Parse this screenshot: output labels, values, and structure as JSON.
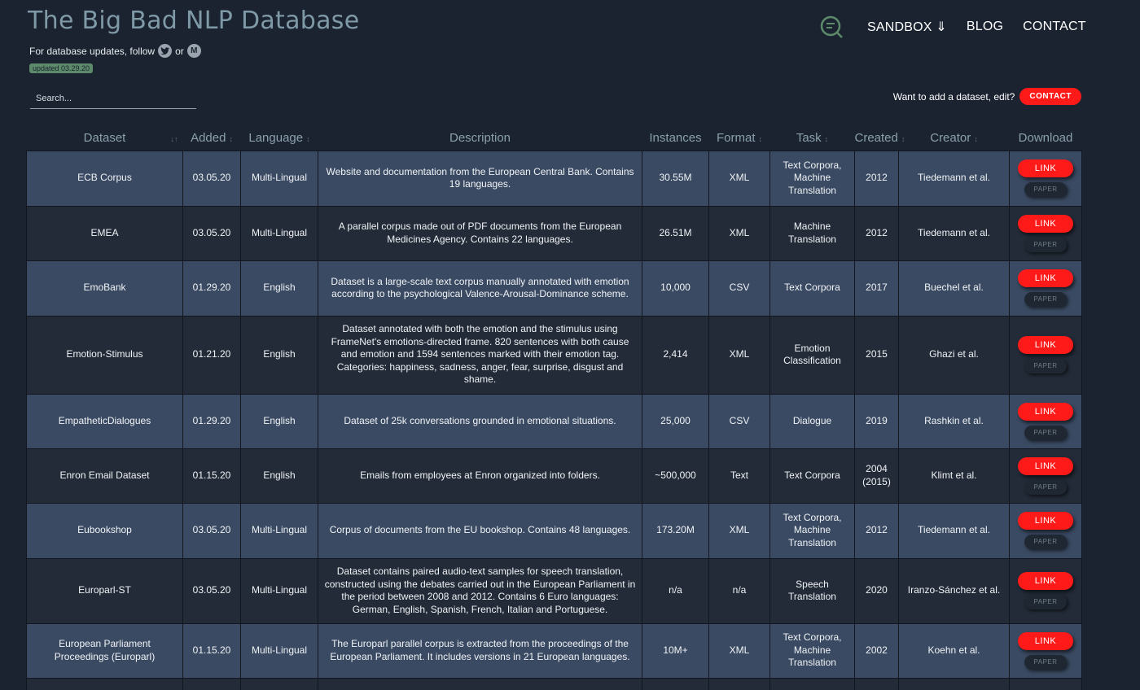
{
  "site": {
    "title": "The Big Bad NLP Database",
    "follow_text": "For database updates, follow",
    "or_text": "or",
    "twitter_icon": "twitter-icon",
    "medium_icon": "medium-icon",
    "updated": "updated 03.29.20"
  },
  "nav": {
    "logo_icon": "q-logo-icon",
    "items": [
      "SANDBOX ⇓",
      "BLOG",
      "CONTACT"
    ]
  },
  "search": {
    "placeholder": "Search..."
  },
  "add_dataset": {
    "text": "Want to add a dataset, edit?",
    "button": "CONTACT"
  },
  "colors": {
    "accent": "#ff1a1a",
    "title": "#7f9aa6",
    "row_odd": "#3a4a62",
    "row_even": "#232b38",
    "background": "#1b2331"
  },
  "table": {
    "headers": [
      "Dataset",
      "Added",
      "Language",
      "Description",
      "Instances",
      "Format",
      "Task",
      "Created",
      "Creator",
      "Download"
    ],
    "link_label": "LINK",
    "paper_label": "PAPER",
    "rows": [
      {
        "dataset": "ECB Corpus",
        "added": "03.05.20",
        "language": "Multi-Lingual",
        "description": "Website and documentation from the European Central Bank. Contains 19 languages.",
        "instances": "30.55M",
        "format": "XML",
        "task": "Text Corpora, Machine Translation",
        "created": "2012",
        "creator": "Tiedemann et al."
      },
      {
        "dataset": "EMEA",
        "added": "03.05.20",
        "language": "Multi-Lingual",
        "description": "A parallel corpus made out of PDF documents from the European Medicines Agency. Contains 22 languages.",
        "instances": "26.51M",
        "format": "XML",
        "task": "Machine Translation",
        "created": "2012",
        "creator": "Tiedemann et al."
      },
      {
        "dataset": "EmoBank",
        "added": "01.29.20",
        "language": "English",
        "description": "Dataset is a large-scale text corpus manually annotated with emotion according to the psychological Valence-Arousal-Dominance scheme.",
        "instances": "10,000",
        "format": "CSV",
        "task": "Text Corpora",
        "created": "2017",
        "creator": "Buechel et al."
      },
      {
        "dataset": "Emotion-Stimulus",
        "added": "01.21.20",
        "language": "English",
        "description": "Dataset annotated with both the emotion and the stimulus using FrameNet's emotions-directed frame. 820 sentences with both cause and emotion and 1594 sentences marked with their emotion tag. Categories: happiness, sadness, anger, fear, surprise, disgust and shame.",
        "instances": "2,414",
        "format": "XML",
        "task": "Emotion Classification",
        "created": "2015",
        "creator": "Ghazi et al."
      },
      {
        "dataset": "EmpatheticDialogues",
        "added": "01.29.20",
        "language": "English",
        "description": "Dataset of 25k conversations grounded in emotional situations.",
        "instances": "25,000",
        "format": "CSV",
        "task": "Dialogue",
        "created": "2019",
        "creator": "Rashkin et al."
      },
      {
        "dataset": "Enron Email Dataset",
        "added": "01.15.20",
        "language": "English",
        "description": "Emails from employees at Enron organized into folders.",
        "instances": "~500,000",
        "format": "Text",
        "task": "Text Corpora",
        "created": "2004 (2015)",
        "creator": "Klimt et al."
      },
      {
        "dataset": "Eubookshop",
        "added": "03.05.20",
        "language": "Multi-Lingual",
        "description": "Corpus of documents from the EU bookshop. Contains 48 languages.",
        "instances": "173.20M",
        "format": "XML",
        "task": "Text Corpora, Machine Translation",
        "created": "2012",
        "creator": "Tiedemann et al."
      },
      {
        "dataset": "Europarl-ST",
        "added": "03.05.20",
        "language": "Multi-Lingual",
        "description": "Dataset contains paired audio-text samples for speech translation, constructed using the debates carried out in the European Parliament in the period between 2008 and 2012. Contains 6 Euro languages: German, English, Spanish, French, Italian and Portuguese.",
        "instances": "n/a",
        "format": "n/a",
        "task": "Speech Translation",
        "created": "2020",
        "creator": "Iranzo-Sánchez et al."
      },
      {
        "dataset": "European Parliament Proceedings (Europarl)",
        "added": "01.15.20",
        "language": "Multi-Lingual",
        "description": "The Europarl parallel corpus is extracted from the proceedings of the European Parliament. It includes versions in 21 European languages.",
        "instances": "10M+",
        "format": "XML",
        "task": "Text Corpora, Machine Translation",
        "created": "2002",
        "creator": "Koehn et al."
      }
    ]
  }
}
